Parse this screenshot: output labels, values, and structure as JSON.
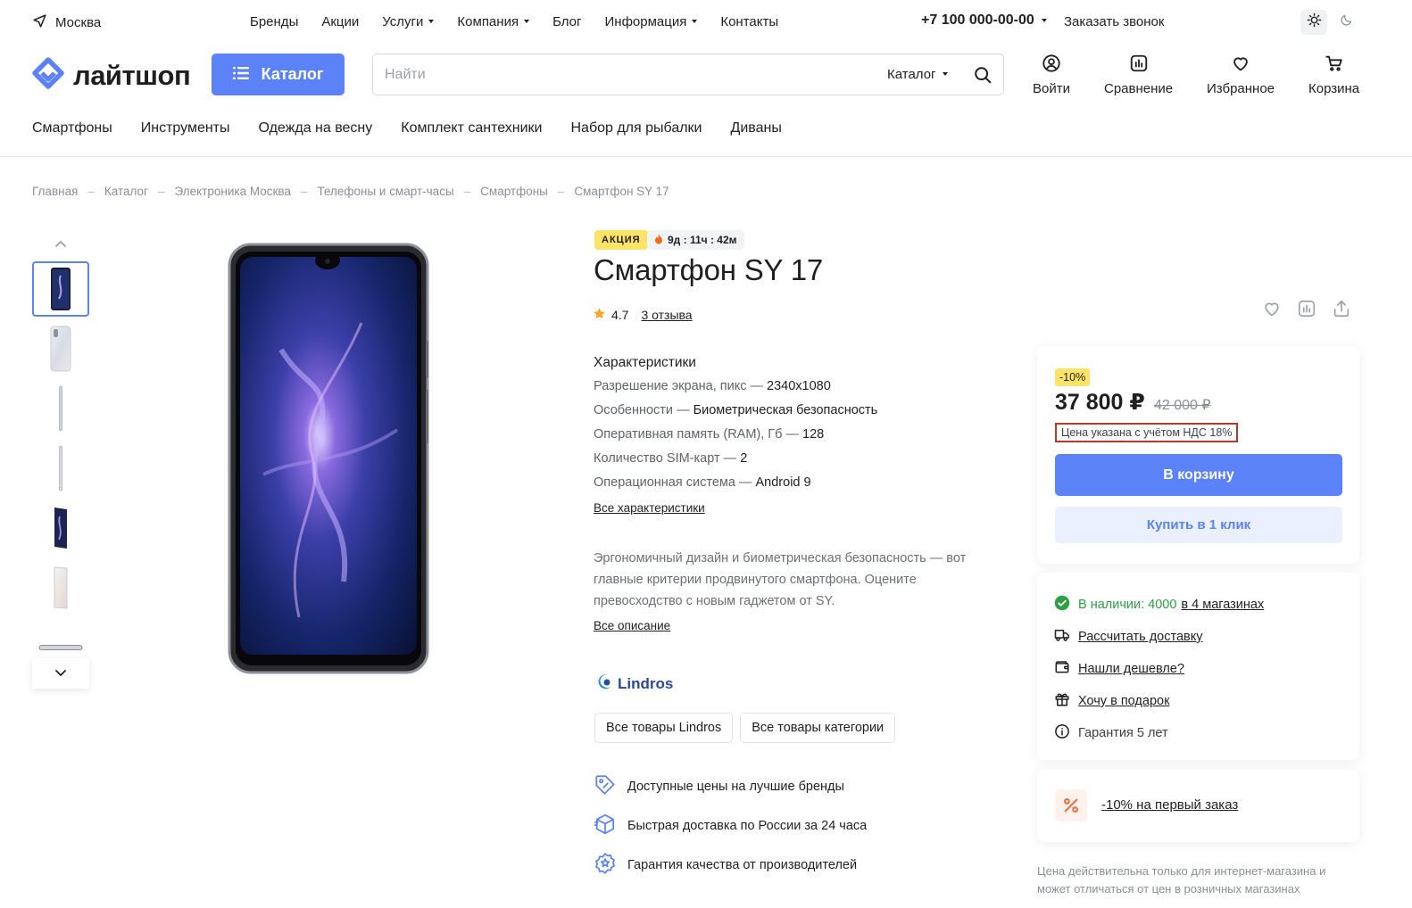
{
  "topbar": {
    "city": "Москва",
    "nav": [
      "Бренды",
      "Акции",
      "Услуги",
      "Компания",
      "Блог",
      "Информация",
      "Контакты"
    ],
    "phone": "+7 100 000-00-00",
    "callback": "Заказать звонок"
  },
  "header": {
    "logo": "лайтшоп",
    "catalog_button": "Каталог",
    "search_placeholder": "Найти",
    "search_scope": "Каталог",
    "icons": {
      "login": "Войти",
      "compare": "Сравнение",
      "favorites": "Избранное",
      "cart": "Корзина"
    }
  },
  "categories": [
    "Смартфоны",
    "Инструменты",
    "Одежда на весну",
    "Комплект сантехники",
    "Набор для рыбалки",
    "Диваны"
  ],
  "breadcrumbs": [
    "Главная",
    "Каталог",
    "Электроника Москва",
    "Телефоны и смарт-часы",
    "Смартфоны",
    "Смартфон SY 17"
  ],
  "product": {
    "sale_badge": "АКЦИЯ",
    "timer": "9д : 11ч : 42м",
    "title": "Смартфон SY 17",
    "rating": "4.7",
    "reviews": "3 отзыва",
    "specs_title": "Характеристики",
    "specs": [
      {
        "name": "Разрешение экрана, пикс",
        "value": "2340x1080"
      },
      {
        "name": "Особенности",
        "value": "Биометрическая безопасность"
      },
      {
        "name": "Оперативная память (RAM), Гб",
        "value": "128"
      },
      {
        "name": "Количество SIM-карт",
        "value": "2"
      },
      {
        "name": "Операционная система",
        "value": "Android 9"
      }
    ],
    "all_specs": "Все характеристики",
    "description": "Эргономичный дизайн и биометрическая безопасность — вот главные критерии продвинутого смартфона. Оцените превосходство с новым гаджетом от SY.",
    "all_description": "Все описание",
    "brand": "Lindros",
    "brand_buttons": [
      "Все товары Lindros",
      "Все товары категории"
    ],
    "perks": [
      "Доступные цены на лучшие бренды",
      "Быстрая доставка по России за 24 часа",
      "Гарантия качества от производителей"
    ]
  },
  "buy": {
    "discount": "-10%",
    "price": "37 800 ₽",
    "old_price": "42 000 ₽",
    "vat_note": "Цена указана с учётом НДС 18%",
    "add_to_cart": "В корзину",
    "one_click": "Купить в 1 клик",
    "stock_label": "В наличии: 4000",
    "stock_link": "в 4 магазинах",
    "delivery": "Рассчитать доставку",
    "cheaper": "Нашли дешевле?",
    "gift": "Хочу в подарок",
    "warranty": "Гарантия 5 лет",
    "promo": "-10% на первый заказ",
    "note": "Цена действительна только для интернет-магазина и может отличаться от цен в розничных магазинах"
  },
  "colors": {
    "accent": "#5b82f7",
    "sale_yellow": "#fde368",
    "in_stock_green": "#2f9e44",
    "brand_blue": "#2c4a91"
  }
}
